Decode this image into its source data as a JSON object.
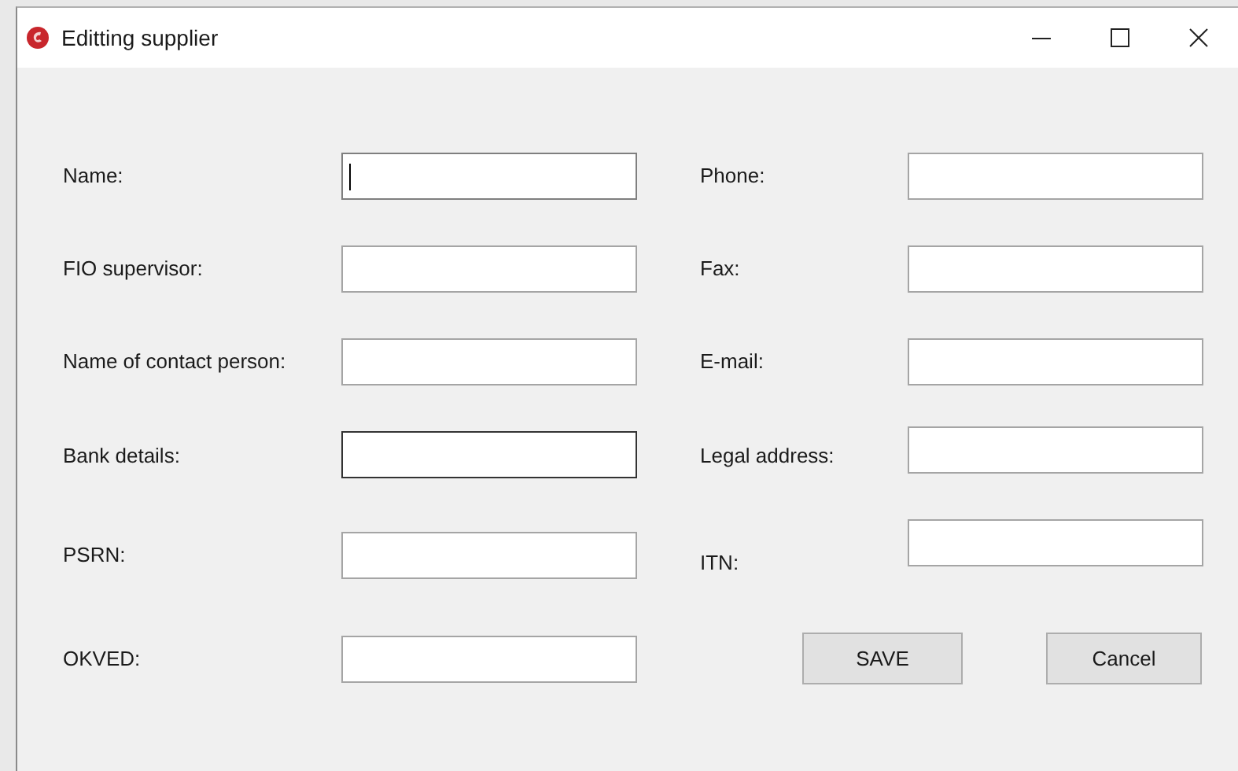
{
  "window": {
    "title": "Editting supplier"
  },
  "left_fields": [
    {
      "label": "Name:",
      "focused": true,
      "hovered": false
    },
    {
      "label": "FIO supervisor:",
      "focused": false,
      "hovered": false
    },
    {
      "label": "Name of contact person:",
      "focused": false,
      "hovered": false
    },
    {
      "label": "Bank details:",
      "focused": false,
      "hovered": true
    },
    {
      "label": "PSRN:",
      "focused": false,
      "hovered": false
    },
    {
      "label": "OKVED:",
      "focused": false,
      "hovered": false
    }
  ],
  "right_fields": [
    {
      "label": "Phone:",
      "focused": false,
      "hovered": false
    },
    {
      "label": "Fax:",
      "focused": false,
      "hovered": false
    },
    {
      "label": "E-mail:",
      "focused": false,
      "hovered": false
    },
    {
      "label": "Legal address:",
      "focused": false,
      "hovered": false
    },
    {
      "label": "ITN:",
      "focused": false,
      "hovered": false
    }
  ],
  "buttons": [
    {
      "label": "SAVE"
    },
    {
      "label": "Cancel"
    }
  ]
}
